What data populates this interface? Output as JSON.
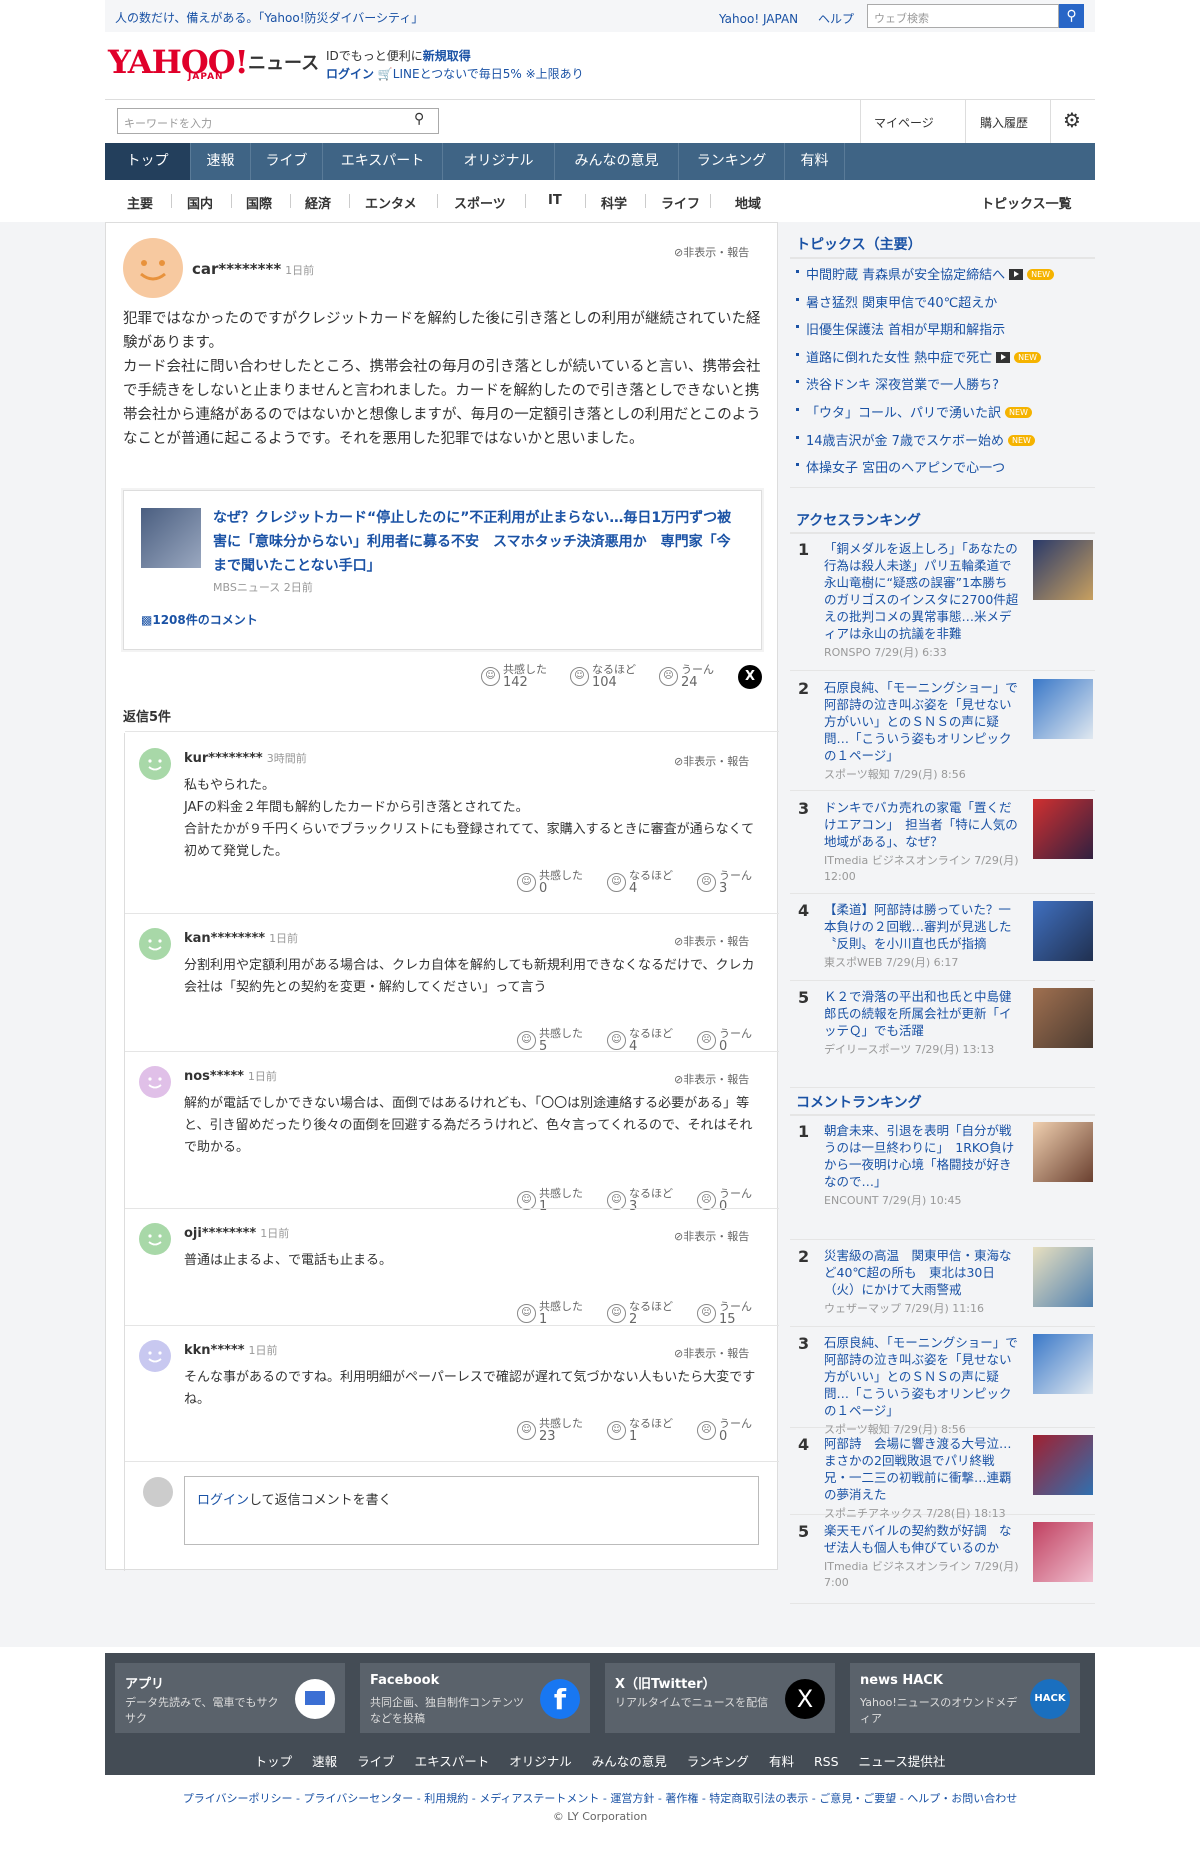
{
  "topbar": {
    "promo": "人の数だけ、備えがある。「Yahoo!防災ダイバーシティ」",
    "links": [
      "Yahoo! JAPAN",
      "ヘルプ"
    ],
    "search_placeholder": "ウェブ検索"
  },
  "logo": {
    "main": "YAHOO!",
    "sub": "JAPAN",
    "news": "ニュース"
  },
  "promo2": {
    "line1_a": "IDでもっと便利に",
    "line1_b": "新規取得",
    "line2_a": "ログイン",
    "line2_b": "LINEとつないで毎日5% ※上限あり"
  },
  "searchbar": {
    "placeholder": "キーワードを入力",
    "mypage": "マイページ",
    "history": "購入履歴"
  },
  "global_nav": [
    "トップ",
    "速報",
    "ライブ",
    "エキスパート",
    "オリジナル",
    "みんなの意見",
    "ランキング",
    "有料"
  ],
  "sub_nav": [
    "主要",
    "国内",
    "国際",
    "経済",
    "エンタメ",
    "スポーツ",
    "IT",
    "科学",
    "ライフ",
    "地域"
  ],
  "sub_nav_right": "トピックス一覧",
  "comment": {
    "user": "car********",
    "time": "1日前",
    "report": "非表示・報告",
    "body": "犯罪ではなかったのですがクレジットカードを解約した後に引き落としの利用が継続されていた経験があります。\nカード会社に問い合わせしたところ、携帯会社の毎月の引き落としが続いていると言い、携帯会社で手続きをしないと止まりませんと言われました。カードを解約したので引き落としできないと携帯会社から連絡があるのではないかと想像しますが、毎月の一定額引き落としの利用だとこのようなことが普通に起こるようです。それを悪用した犯罪ではないかと思いました。",
    "article": {
      "title": "なぜ？クレジットカード“停止したのに”不正利用が止まらない…毎日1万円ずつ被害に「意味分からない」利用者に募る不安　スマホタッチ決済悪用か　専門家「今まで聞いたことない手口」",
      "source": "MBSニュース 2日前",
      "comments": "1208件のコメント"
    },
    "reactions": [
      {
        "label": "共感した",
        "count": "142"
      },
      {
        "label": "なるほど",
        "count": "104"
      },
      {
        "label": "うーん",
        "count": "24"
      }
    ]
  },
  "replies_label": "返信5件",
  "replies": [
    {
      "user": "kur********",
      "time": "3時間前",
      "color": "#a8d8a8",
      "body": "私もやられた。\nJAFの料金２年間も解約したカードから引き落とされてた。\n合計たかが９千円くらいでブラックリストにも登録されてて、家購入するときに審査が通らなくて初めて発覚した。",
      "counts": [
        "0",
        "4",
        "3"
      ]
    },
    {
      "user": "kan********",
      "time": "1日前",
      "color": "#a8d8a8",
      "body": "分割利用や定額利用がある場合は、クレカ自体を解約しても新規利用できなくなるだけで、クレカ会社は「契約先との契約を変更・解約してください」って言う",
      "counts": [
        "5",
        "4",
        "0"
      ]
    },
    {
      "user": "nos*****",
      "time": "1日前",
      "color": "#e0c0e8",
      "body": "解約が電話でしかできない場合は、面倒ではあるけれども、「〇〇は別途連絡する必要がある」等と、引き留めだったり後々の面倒を回避する為だろうけれど、色々言ってくれるので、それはそれで助かる。",
      "counts": [
        "1",
        "3",
        "0"
      ]
    },
    {
      "user": "oji********",
      "time": "1日前",
      "color": "#a8d8a8",
      "body": "普通は止まるよ、で電話も止まる。",
      "counts": [
        "1",
        "2",
        "15"
      ]
    },
    {
      "user": "kkn*****",
      "time": "1日前",
      "color": "#c8c8f0",
      "body": "そんな事があるのですね。利用明細がペーパーレスで確認が遅れて気づかない人もいたら大変ですね。",
      "counts": [
        "23",
        "1",
        "0"
      ]
    }
  ],
  "reaction_labels": [
    "共感した",
    "なるほど",
    "うーん"
  ],
  "reply_form": {
    "login": "ログイン",
    "rest": "して返信コメントを書く"
  },
  "topics": {
    "heading": "トピックス（主要）",
    "items": [
      {
        "text": "中間貯蔵 青森県が安全協定締結へ",
        "video": true,
        "new": true
      },
      {
        "text": "暑さ猛烈 関東甲信で40℃超えか",
        "video": false,
        "new": false
      },
      {
        "text": "旧優生保護法 首相が早期和解指示",
        "video": false,
        "new": false
      },
      {
        "text": "道路に倒れた女性 熱中症で死亡",
        "video": true,
        "new": true
      },
      {
        "text": "渋谷ドンキ 深夜営業で一人勝ち?",
        "video": false,
        "new": false
      },
      {
        "text": "「ウタ」コール、パリで湧いた訳",
        "video": false,
        "new": true
      },
      {
        "text": "14歳吉沢が金 7歳でスケボー始め",
        "video": false,
        "new": true
      },
      {
        "text": "体操女子 宮田のヘアピンで心一つ",
        "video": false,
        "new": false
      }
    ],
    "new_label": "NEW"
  },
  "access_ranking": {
    "heading": "アクセスランキング",
    "items": [
      {
        "num": "1",
        "title": "「銅メダルを返上しろ」「あなたの行為は殺人未遂」パリ五輪柔道で永山竜樹に“疑惑の誤審”1本勝ちのガリゴスのインスタに2700件超えの批判コメの異常事態…米メディアは永山の抗議を非難",
        "source": "RONSPO 7/29(月) 6:33"
      },
      {
        "num": "2",
        "title": "石原良純、「モーニングショー」で阿部詩の泣き叫ぶ姿を「見せない方がいい」とのＳＮＳの声に疑問…「こういう姿もオリンピックの１ページ」",
        "source": "スポーツ報知 7/29(月) 8:56"
      },
      {
        "num": "3",
        "title": "ドンキでバカ売れの家電「置くだけエアコン」　担当者「特に人気の地域がある」、なぜ？",
        "source": "ITmedia ビジネスオンライン 7/29(月) 12:00"
      },
      {
        "num": "4",
        "title": "【柔道】阿部詩は勝っていた？一本負けの２回戦…審判が見逃した〝反則〟を小川直也氏が指摘",
        "source": "東スポWEB 7/29(月) 6:17"
      },
      {
        "num": "5",
        "title": "Ｋ２で滑落の平出和也氏と中島健郎氏の続報を所属会社が更新「イッテＱ」でも活躍",
        "source": "デイリースポーツ 7/29(月) 13:13"
      }
    ]
  },
  "comment_ranking": {
    "heading": "コメントランキング",
    "items": [
      {
        "num": "1",
        "title": "朝倉未来、引退を表明「自分が戦うのは一旦終わりに」　1RKO負けから一夜明け心境「格闘技が好きなので…」",
        "source": "ENCOUNT 7/29(月) 10:45"
      },
      {
        "num": "2",
        "title": "災害級の高温　関東甲信・東海など40℃超の所も　東北は30日（火）にかけて大雨警戒",
        "source": "ウェザーマップ 7/29(月) 11:16"
      },
      {
        "num": "3",
        "title": "石原良純、「モーニングショー」で阿部詩の泣き叫ぶ姿を「見せない方がいい」とのＳＮＳの声に疑問…「こういう姿もオリンピックの１ページ」",
        "source": "スポーツ報知 7/29(月) 8:56"
      },
      {
        "num": "4",
        "title": "阿部詩　会場に響き渡る大号泣…まさかの2回戦敗退でパリ終戦　兄・一二三の初戦前に衝撃…連覇の夢消えた",
        "source": "スポニチアネックス 7/28(日) 18:13"
      },
      {
        "num": "5",
        "title": "楽天モバイルの契約数が好調　なぜ法人も個人も伸びているのか",
        "source": "ITmedia ビジネスオンライン 7/29(月) 7:00"
      }
    ]
  },
  "footer": {
    "cards": [
      {
        "title": "アプリ",
        "desc": "データ先読みで、電車でもサクサク"
      },
      {
        "title": "Facebook",
        "desc": "共同企画、独自制作コンテンツなどを投稿"
      },
      {
        "title": "X（旧Twitter）",
        "desc": "リアルタイムでニュースを配信"
      },
      {
        "title": "news HACK",
        "desc": "Yahoo!ニュースのオウンドメディア"
      }
    ],
    "nav": [
      "トップ",
      "速報",
      "ライブ",
      "エキスパート",
      "オリジナル",
      "みんなの意見",
      "ランキング",
      "有料",
      "RSS",
      "ニュース提供社"
    ],
    "legal": "プライバシーポリシー - プライバシーセンター - 利用規約 - メディアステートメント - 運営方針 - 著作権 - 特定商取引法の表示 - ご意見・ご要望 - ヘルプ・お問い合わせ",
    "copyright": "© LY Corporation"
  }
}
